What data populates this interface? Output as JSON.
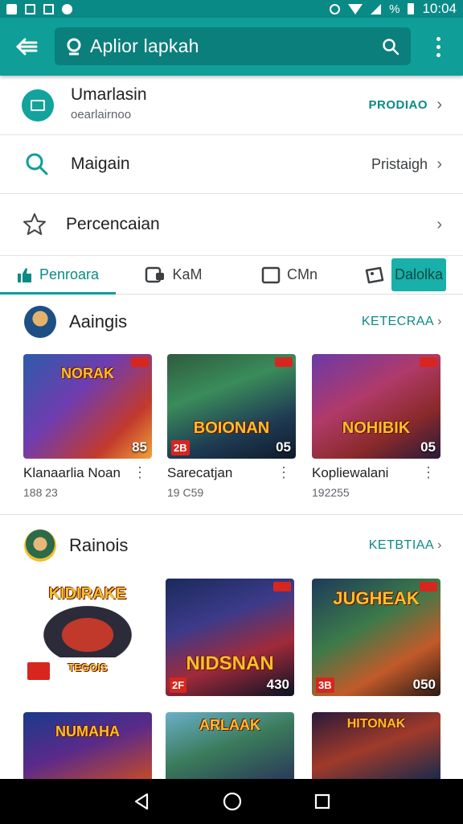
{
  "status_bar": {
    "time": "10:04",
    "battery": "%"
  },
  "app_bar": {
    "search_text": "Aplior lapkah"
  },
  "rows": [
    {
      "title": "Umarlasin",
      "subtitle": "oearlairnoo",
      "action": "PRODIAO"
    },
    {
      "title": "Maigain",
      "action": "Pristaigh"
    },
    {
      "title": "Percencaian"
    }
  ],
  "tabs": [
    {
      "label": "Penroara",
      "icon": "thumbs-up-icon"
    },
    {
      "label": "KaM",
      "icon": "tablet-icon"
    },
    {
      "label": "CMn",
      "icon": "square-icon"
    },
    {
      "label": "Dalolka",
      "icon": "image-icon"
    }
  ],
  "sections": [
    {
      "title": "Aaingis",
      "link": "KETECRAA",
      "cards": [
        {
          "title": "Klanaarlia Noan",
          "subtitle": "188 23",
          "num": "85",
          "art": "NORAK"
        },
        {
          "title": "Sarecatjan",
          "subtitle": "19 C59",
          "num": "05",
          "badge": "2B",
          "art": "BOIONAN"
        },
        {
          "title": "Kopliewalani",
          "subtitle": "192255",
          "num": "05",
          "art": "NOHIBIK"
        }
      ]
    },
    {
      "title": "Rainois",
      "link": "KETBTIAA",
      "cards": [
        {
          "badge": "",
          "art": "KIDIRAKE",
          "sub_art": "TEGOIS"
        },
        {
          "num": "430",
          "badge": "2F",
          "art": "NIDSNAN"
        },
        {
          "num": "050",
          "badge": "3B",
          "art": "JUGHEAK"
        }
      ]
    }
  ],
  "third_row_cards": [
    {
      "art": "NUMAHA"
    },
    {
      "art": "ARLAAK"
    },
    {
      "art": "HITONAK"
    }
  ],
  "colors": {
    "primary": "#0f9e98",
    "primary_dark": "#0a8a86",
    "accent_text": "#0b8a85"
  }
}
